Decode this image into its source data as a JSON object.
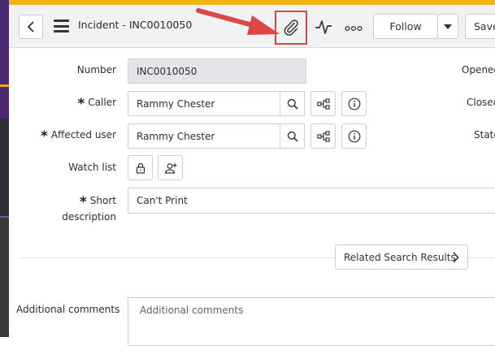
{
  "header": {
    "title": "Incident - INC0010050",
    "follow_label": "Follow",
    "save_label": "Save",
    "icons": {
      "back": "chevron-left-icon",
      "menu": "hamburger-menu-icon",
      "attachment": "paperclip-icon",
      "activity": "activity-stream-icon",
      "more": "more-options-icon",
      "follow_dropdown": "caret-down-icon"
    }
  },
  "form": {
    "number": {
      "label": "Number",
      "value": "INC0010050"
    },
    "caller": {
      "label": "Caller",
      "value": "Rammy Chester"
    },
    "affected_user": {
      "label": "Affected user",
      "value": "Rammy Chester"
    },
    "watch_list": {
      "label": "Watch list"
    },
    "short_description": {
      "label_line1": "Short",
      "label_line2": "description",
      "value": "Can't Print"
    },
    "right_labels": {
      "opened": "Opened",
      "closed": "Closed",
      "state": "State"
    },
    "related_search_label": "Related Search Results",
    "additional_comments": {
      "label": "Additional comments",
      "placeholder": "Additional comments"
    }
  },
  "colors": {
    "accent_yellow": "#f3b515",
    "sidebar_purple": "#4b2a74",
    "highlight_red": "#e04545"
  }
}
